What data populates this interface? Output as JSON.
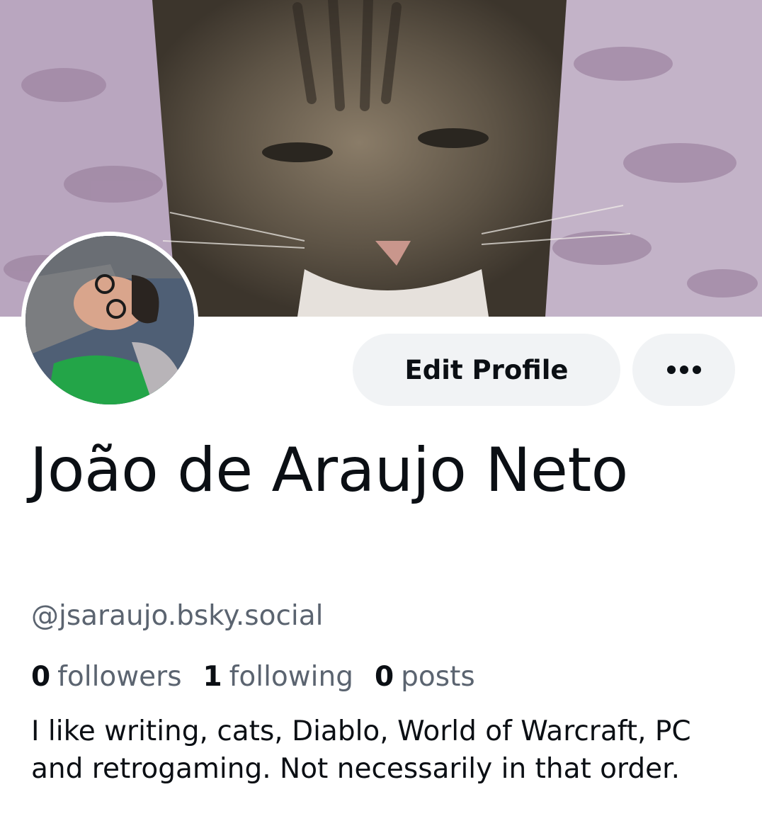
{
  "profile": {
    "display_name": "João de Araujo Neto",
    "handle": "@jsaraujo.bsky.social",
    "bio": "I like writing, cats, Diablo, World of Warcraft, PC and retrogaming. Not necessarily in that order."
  },
  "actions": {
    "edit_profile_label": "Edit Profile",
    "more_icon": "ellipsis-icon"
  },
  "stats": {
    "followers": {
      "count": "0",
      "label": "followers"
    },
    "following": {
      "count": "1",
      "label": "following"
    },
    "posts": {
      "count": "0",
      "label": "posts"
    }
  },
  "colors": {
    "button_bg": "#f1f3f5",
    "text_primary": "#0b0f14",
    "text_secondary": "#5b6470"
  }
}
